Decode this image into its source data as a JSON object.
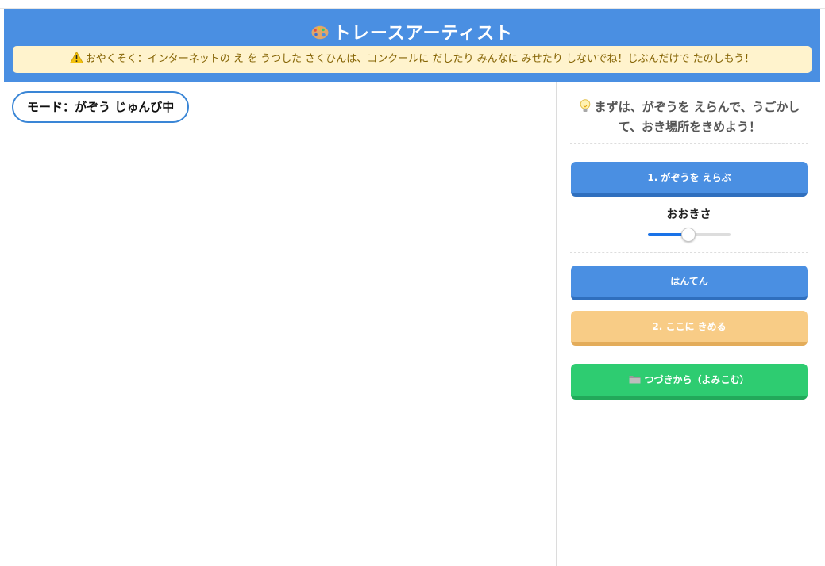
{
  "header": {
    "title": "トレースアーティスト",
    "icon": "palette-icon"
  },
  "warning": {
    "icon": "warning-icon",
    "text": "おやくそく：インターネットの え を うつした さくひんは、コンクールに だしたり みんなに みせたり しないでね！じぶんだけで たのしもう！"
  },
  "canvas": {
    "mode_label": "モード：がぞう じゅんび中"
  },
  "panel": {
    "hint_icon": "lightbulb-icon",
    "hint_text": "まずは、がぞうを えらんで、うごかして、おき場所をきめよう！",
    "select_image_button": "1. がぞうを えらぶ",
    "size_label": "おおきさ",
    "size_level": 0.48,
    "flip_button": "はんてん",
    "place_button": "2. ここに きめる",
    "load_icon": "folder-icon",
    "load_button": "つづきから（よみこむ）"
  },
  "colors": {
    "header": "#4a8fe2",
    "warning_bg": "#fff3cd",
    "warning_text": "#856404",
    "primary_button": "#4a8fe2",
    "disabled_button": "#f8cc86",
    "load_button": "#2ecc71",
    "slider_accent": "#1a73e8"
  }
}
